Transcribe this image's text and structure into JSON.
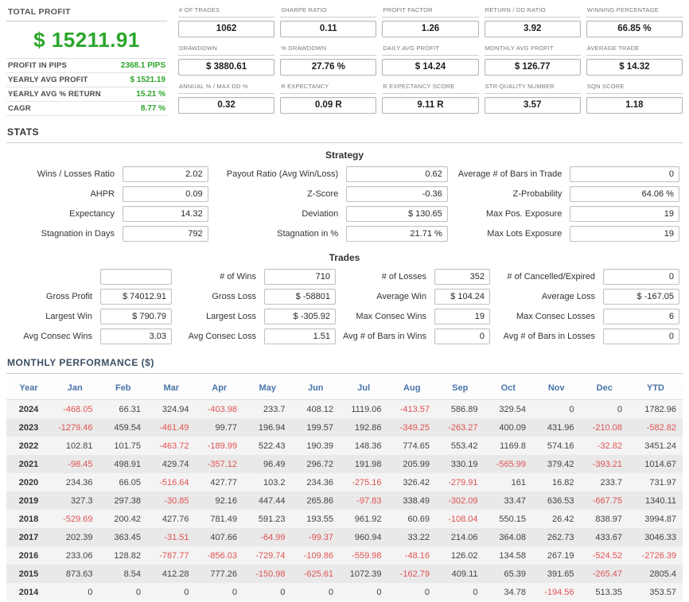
{
  "colors": {
    "profit_green": "#2aa62a",
    "negative_red": "#e05353",
    "header_blue": "#4a74a8"
  },
  "summary": {
    "total_profit_label": "TOTAL PROFIT",
    "total_profit_value": "$ 15211.91",
    "rows": [
      {
        "label": "PROFIT IN PIPS",
        "value": "2368.1 PIPS"
      },
      {
        "label": "YEARLY AVG PROFIT",
        "value": "$ 1521.19"
      },
      {
        "label": "YEARLY AVG % RETURN",
        "value": "15.21 %"
      },
      {
        "label": "CAGR",
        "value": "8.77 %"
      }
    ]
  },
  "metrics": [
    [
      {
        "label": "# OF TRADES",
        "value": "1062"
      },
      {
        "label": "SHARPE RATIO",
        "value": "0.11"
      },
      {
        "label": "PROFIT FACTOR",
        "value": "1.26"
      },
      {
        "label": "RETURN / DD RATIO",
        "value": "3.92"
      },
      {
        "label": "WINNING PERCENTAGE",
        "value": "66.85 %"
      }
    ],
    [
      {
        "label": "DRAWDOWN",
        "value": "$ 3880.61"
      },
      {
        "label": "% DRAWDOWN",
        "value": "27.76 %"
      },
      {
        "label": "DAILY AVG PROFIT",
        "value": "$ 14.24"
      },
      {
        "label": "MONTHLY AVG PROFIT",
        "value": "$ 126.77"
      },
      {
        "label": "AVERAGE TRADE",
        "value": "$ 14.32"
      }
    ],
    [
      {
        "label": "ANNUAL % / MAX DD %",
        "value": "0.32"
      },
      {
        "label": "R EXPECTANCY",
        "value": "0.09 R"
      },
      {
        "label": "R EXPECTANCY SCORE",
        "value": "9.11 R"
      },
      {
        "label": "STR QUALITY NUMBER",
        "value": "3.57"
      },
      {
        "label": "SQN SCORE",
        "value": "1.18"
      }
    ]
  ],
  "stats": {
    "section_title": "STATS",
    "strategy": {
      "title": "Strategy",
      "rows": [
        [
          {
            "label": "Wins / Losses Ratio",
            "value": "2.02"
          },
          {
            "label": "Payout Ratio (Avg Win/Loss)",
            "value": "0.62"
          },
          {
            "label": "Average # of Bars in Trade",
            "value": "0"
          }
        ],
        [
          {
            "label": "AHPR",
            "value": "0.09"
          },
          {
            "label": "Z-Score",
            "value": "-0.36"
          },
          {
            "label": "Z-Probability",
            "value": "64.06 %"
          }
        ],
        [
          {
            "label": "Expectancy",
            "value": "14.32"
          },
          {
            "label": "Deviation",
            "value": "$ 130.65"
          },
          {
            "label": "Max Pos. Exposure",
            "value": "19"
          }
        ],
        [
          {
            "label": "Stagnation in Days",
            "value": "792"
          },
          {
            "label": "Stagnation in %",
            "value": "21.71 %"
          },
          {
            "label": "Max Lots Exposure",
            "value": "19"
          }
        ]
      ]
    },
    "trades": {
      "title": "Trades",
      "rows": [
        [
          {
            "label": "",
            "value": ""
          },
          {
            "label": "# of Wins",
            "value": "710"
          },
          {
            "label": "# of Losses",
            "value": "352"
          },
          {
            "label": "# of Cancelled/Expired",
            "value": "0"
          }
        ],
        [
          {
            "label": "Gross Profit",
            "value": "$ 74012.91"
          },
          {
            "label": "Gross Loss",
            "value": "$ -58801"
          },
          {
            "label": "Average Win",
            "value": "$ 104.24"
          },
          {
            "label": "Average Loss",
            "value": "$ -167.05"
          }
        ],
        [
          {
            "label": "Largest Win",
            "value": "$ 790.79"
          },
          {
            "label": "Largest Loss",
            "value": "$ -305.92"
          },
          {
            "label": "Max Consec Wins",
            "value": "19"
          },
          {
            "label": "Max Consec Losses",
            "value": "6"
          }
        ],
        [
          {
            "label": "Avg Consec Wins",
            "value": "3.03"
          },
          {
            "label": "Avg Consec Loss",
            "value": "1.51"
          },
          {
            "label": "Avg # of Bars in Wins",
            "value": "0"
          },
          {
            "label": "Avg # of Bars in Losses",
            "value": "0"
          }
        ]
      ]
    }
  },
  "monthly": {
    "section_title": "MONTHLY PERFORMANCE ($)",
    "columns": [
      "Year",
      "Jan",
      "Feb",
      "Mar",
      "Apr",
      "May",
      "Jun",
      "Jul",
      "Aug",
      "Sep",
      "Oct",
      "Nov",
      "Dec",
      "YTD"
    ],
    "rows": [
      {
        "year": "2024",
        "values": [
          "-468.05",
          "66.31",
          "324.94",
          "-403.98",
          "233.7",
          "408.12",
          "1119.06",
          "-413.57",
          "586.89",
          "329.54",
          "0",
          "0",
          "1782.96"
        ]
      },
      {
        "year": "2023",
        "values": [
          "-1279.46",
          "459.54",
          "-461.49",
          "99.77",
          "196.94",
          "199.57",
          "192.86",
          "-349.25",
          "-263.27",
          "400.09",
          "431.96",
          "-210.08",
          "-582.82"
        ]
      },
      {
        "year": "2022",
        "values": [
          "102.81",
          "101.75",
          "-463.72",
          "-189.99",
          "522.43",
          "190.39",
          "148.36",
          "774.65",
          "553.42",
          "1169.8",
          "574.16",
          "-32.82",
          "3451.24"
        ]
      },
      {
        "year": "2021",
        "values": [
          "-98.45",
          "498.91",
          "429.74",
          "-357.12",
          "96.49",
          "296.72",
          "191.98",
          "205.99",
          "330.19",
          "-565.99",
          "379.42",
          "-393.21",
          "1014.67"
        ]
      },
      {
        "year": "2020",
        "values": [
          "234.36",
          "66.05",
          "-516.64",
          "427.77",
          "103.2",
          "234.36",
          "-275.16",
          "326.42",
          "-279.91",
          "161",
          "16.82",
          "233.7",
          "731.97"
        ]
      },
      {
        "year": "2019",
        "values": [
          "327.3",
          "297.38",
          "-30.85",
          "92.16",
          "447.44",
          "265.86",
          "-97.83",
          "338.49",
          "-302.09",
          "33.47",
          "636.53",
          "-667.75",
          "1340.11"
        ]
      },
      {
        "year": "2018",
        "values": [
          "-529.69",
          "200.42",
          "427.76",
          "781.49",
          "591.23",
          "193.55",
          "961.92",
          "60.69",
          "-108.04",
          "550.15",
          "26.42",
          "838.97",
          "3994.87"
        ]
      },
      {
        "year": "2017",
        "values": [
          "202.39",
          "363.45",
          "-31.51",
          "407.66",
          "-64.99",
          "-99.37",
          "960.94",
          "33.22",
          "214.06",
          "364.08",
          "262.73",
          "433.67",
          "3046.33"
        ]
      },
      {
        "year": "2016",
        "values": [
          "233.06",
          "128.82",
          "-787.77",
          "-856.03",
          "-729.74",
          "-109.86",
          "-559.98",
          "-48.16",
          "126.02",
          "134.58",
          "267.19",
          "-524.52",
          "-2726.39"
        ]
      },
      {
        "year": "2015",
        "values": [
          "873.63",
          "8.54",
          "412.28",
          "777.26",
          "-150.98",
          "-625.61",
          "1072.39",
          "-162.79",
          "409.11",
          "65.39",
          "391.65",
          "-265.47",
          "2805.4"
        ]
      },
      {
        "year": "2014",
        "values": [
          "0",
          "0",
          "0",
          "0",
          "0",
          "0",
          "0",
          "0",
          "0",
          "34.78",
          "-194.56",
          "513.35",
          "353.57"
        ]
      }
    ]
  }
}
